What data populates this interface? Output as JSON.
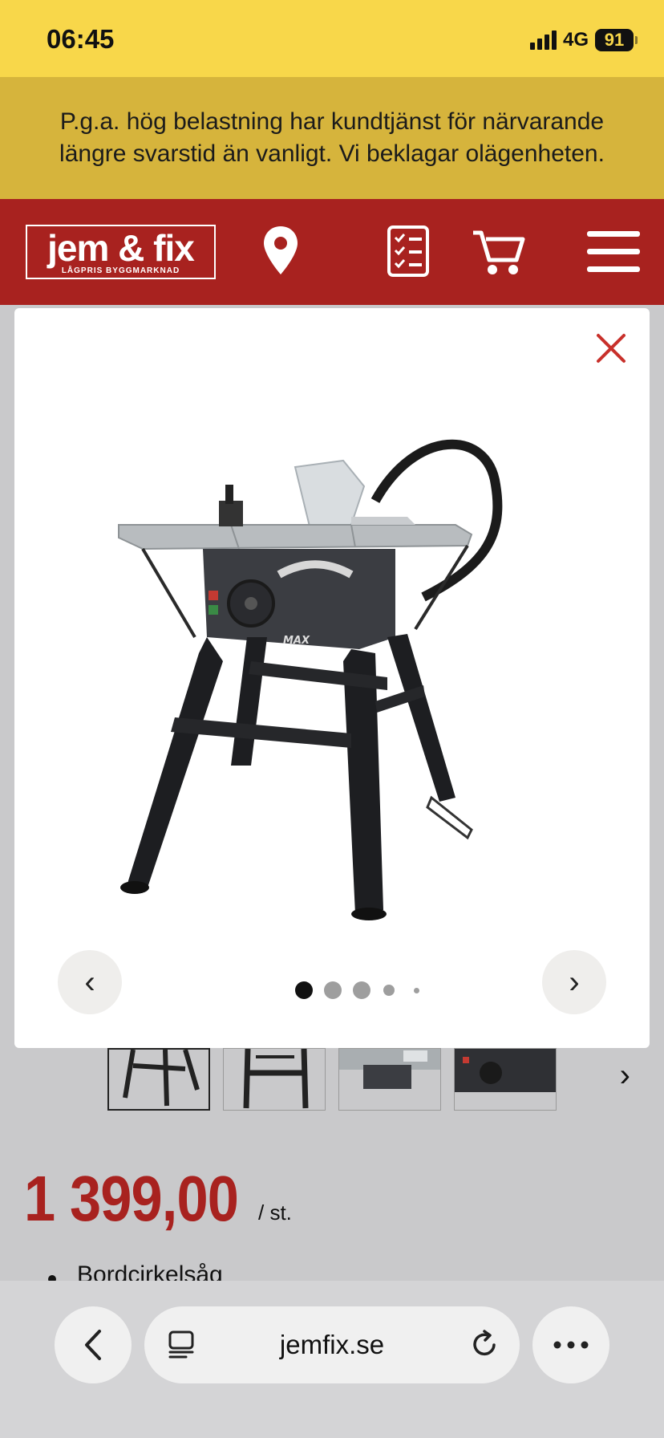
{
  "status_bar": {
    "time": "06:45",
    "network": "4G",
    "battery": "91"
  },
  "notice": {
    "text": "P.g.a. hög belastning har kundtjänst för närvarande längre svarstid än vanligt. Vi beklagar olägenheten."
  },
  "header": {
    "logo_name": "jem & fix",
    "logo_tagline": "LÅGPRIS BYGGMARKNAD",
    "icons": [
      "location-icon",
      "list-icon",
      "cart-icon",
      "menu-icon"
    ]
  },
  "gallery": {
    "prev_label": "‹",
    "next_label": "›",
    "dots": 5,
    "active_dot": 0,
    "close_icon": "close-icon",
    "image_label": "MAX",
    "thumbs_next_label": "›"
  },
  "product": {
    "price": "1 399,00",
    "unit": "/ st.",
    "bullets": [
      "Bordcirkelsåg"
    ]
  },
  "browser": {
    "url": "jemfix.se"
  },
  "colors": {
    "brand_red": "#a8221f",
    "status_yellow": "#f8d74a",
    "notice_yellow": "#d6b43c"
  }
}
